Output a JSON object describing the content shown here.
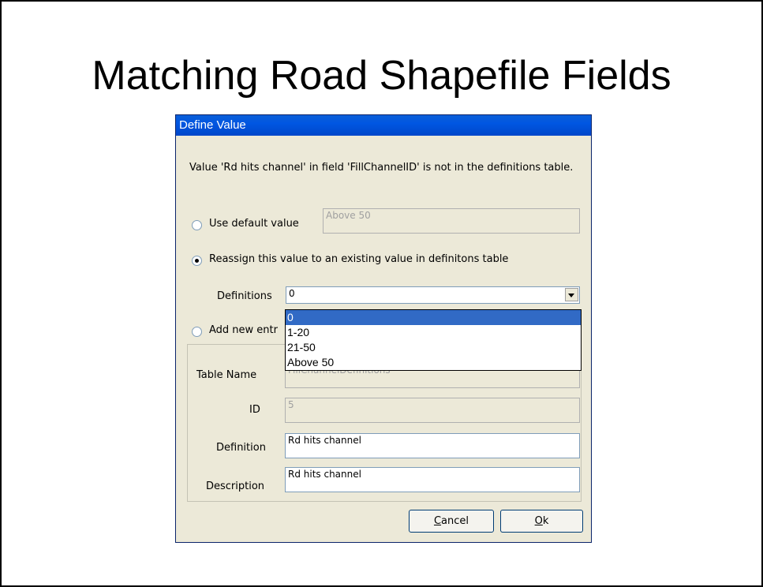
{
  "slide": {
    "title": "Matching Road Shapefile Fields"
  },
  "dialog": {
    "title": "Define Value",
    "message": "Value 'Rd hits channel' in field 'FillChannelID' is not in the definitions table.",
    "option_default": {
      "label": "Use default value",
      "value": "Above 50",
      "checked": false
    },
    "option_reassign": {
      "label": "Reassign this value to an existing value in definitons table",
      "checked": true
    },
    "definitions": {
      "label": "Definitions",
      "selected": "0",
      "options": [
        "0",
        "1-20",
        "21-50",
        "Above 50"
      ]
    },
    "option_new": {
      "label": "Add new entr",
      "checked": false
    },
    "table_name": {
      "label": "Table Name",
      "value": "FillChannelDefinitions"
    },
    "id": {
      "label": "ID",
      "value": "5"
    },
    "definition": {
      "label": "Definition",
      "value": "Rd hits channel"
    },
    "description": {
      "label": "Description",
      "value": "Rd hits channel"
    },
    "buttons": {
      "cancel_first": "C",
      "cancel_rest": "ancel",
      "ok_first": "O",
      "ok_rest": "k"
    }
  }
}
